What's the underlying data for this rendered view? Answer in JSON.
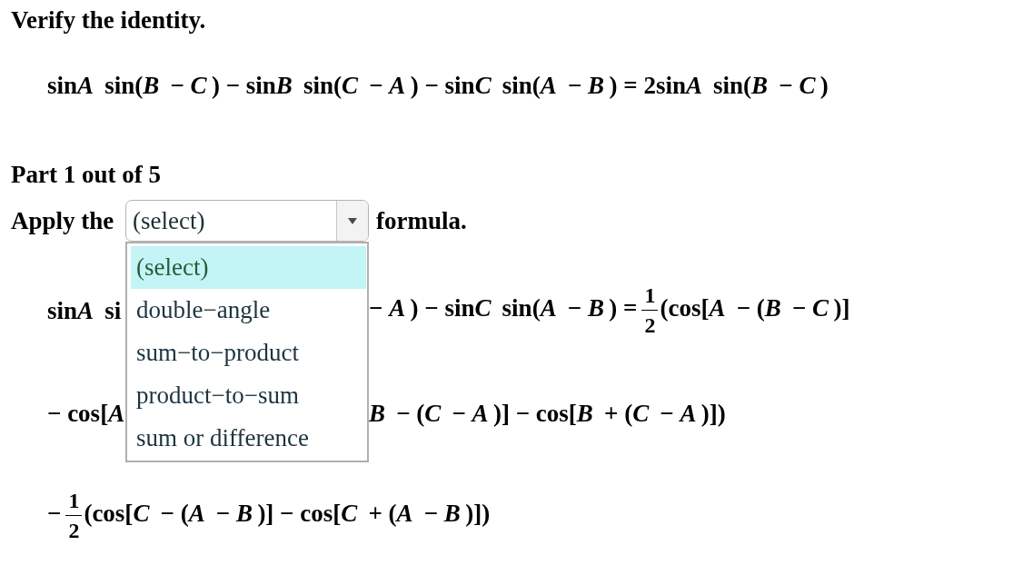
{
  "heading": "Verify the identity.",
  "identity": [
    {
      "kind": "text",
      "text": "sin"
    },
    {
      "kind": "var",
      "text": "A"
    },
    {
      "kind": "text",
      "text": " sin("
    },
    {
      "kind": "var",
      "text": "B"
    },
    {
      "kind": "text",
      "text": " − "
    },
    {
      "kind": "var",
      "text": "C"
    },
    {
      "kind": "text",
      "text": ") − sin"
    },
    {
      "kind": "var",
      "text": "B"
    },
    {
      "kind": "text",
      "text": " sin("
    },
    {
      "kind": "var",
      "text": "C"
    },
    {
      "kind": "text",
      "text": " − "
    },
    {
      "kind": "var",
      "text": "A"
    },
    {
      "kind": "text",
      "text": ") − sin"
    },
    {
      "kind": "var",
      "text": "C"
    },
    {
      "kind": "text",
      "text": " sin("
    },
    {
      "kind": "var",
      "text": "A"
    },
    {
      "kind": "text",
      "text": " − "
    },
    {
      "kind": "var",
      "text": "B"
    },
    {
      "kind": "text",
      "text": ") = 2sin"
    },
    {
      "kind": "var",
      "text": "A"
    },
    {
      "kind": "text",
      "text": " sin("
    },
    {
      "kind": "var",
      "text": "B"
    },
    {
      "kind": "text",
      "text": " − "
    },
    {
      "kind": "var",
      "text": "C"
    },
    {
      "kind": "text",
      "text": ")"
    }
  ],
  "part": "Part 1 out of 5",
  "prompt": {
    "before": "Apply the",
    "select": {
      "value": "(select)",
      "expanded": true,
      "options": [
        {
          "label": "(select)",
          "selected": true
        },
        {
          "label": "double−angle",
          "selected": false
        },
        {
          "label": "sum−to−product",
          "selected": false
        },
        {
          "label": "product−to−sum",
          "selected": false
        },
        {
          "label": "sum or difference",
          "selected": false
        }
      ]
    },
    "after": "formula."
  },
  "steps": [
    {
      "left": [
        {
          "kind": "text",
          "text": "sin"
        },
        {
          "kind": "var",
          "text": "A"
        },
        {
          "kind": "text",
          "text": " si"
        }
      ],
      "right": [
        {
          "kind": "text",
          "text": "− "
        },
        {
          "kind": "var",
          "text": "A"
        },
        {
          "kind": "text",
          "text": ") − sin"
        },
        {
          "kind": "var",
          "text": "C"
        },
        {
          "kind": "text",
          "text": " sin("
        },
        {
          "kind": "var",
          "text": "A"
        },
        {
          "kind": "text",
          "text": " − "
        },
        {
          "kind": "var",
          "text": "B"
        },
        {
          "kind": "text",
          "text": ") ="
        },
        {
          "kind": "fraction",
          "numerator": "1",
          "denominator": "2"
        },
        {
          "kind": "text",
          "text": "(cos["
        },
        {
          "kind": "var",
          "text": "A"
        },
        {
          "kind": "text",
          "text": " − ("
        },
        {
          "kind": "var",
          "text": "B"
        },
        {
          "kind": "text",
          "text": " − "
        },
        {
          "kind": "var",
          "text": "C"
        },
        {
          "kind": "text",
          "text": ")]"
        }
      ]
    },
    {
      "left": [
        {
          "kind": "text",
          "text": "− cos["
        },
        {
          "kind": "var",
          "text": "A"
        }
      ],
      "right": [
        {
          "kind": "var",
          "text": "B"
        },
        {
          "kind": "text",
          "text": " − ("
        },
        {
          "kind": "var",
          "text": "C"
        },
        {
          "kind": "text",
          "text": " − "
        },
        {
          "kind": "var",
          "text": "A"
        },
        {
          "kind": "text",
          "text": ")] − cos["
        },
        {
          "kind": "var",
          "text": "B"
        },
        {
          "kind": "text",
          "text": " + ("
        },
        {
          "kind": "var",
          "text": "C"
        },
        {
          "kind": "text",
          "text": " − "
        },
        {
          "kind": "var",
          "text": "A"
        },
        {
          "kind": "text",
          "text": ")])"
        }
      ]
    },
    {
      "left": [
        {
          "kind": "text",
          "text": "−"
        },
        {
          "kind": "fraction",
          "numerator": "1",
          "denominator": "2"
        },
        {
          "kind": "text",
          "text": "(cos["
        },
        {
          "kind": "var",
          "text": "C"
        },
        {
          "kind": "text",
          "text": " − ("
        },
        {
          "kind": "var",
          "text": "A"
        },
        {
          "kind": "text",
          "text": " − "
        },
        {
          "kind": "var",
          "text": "B"
        },
        {
          "kind": "text",
          "text": ")] − cos["
        },
        {
          "kind": "var",
          "text": "C"
        },
        {
          "kind": "text",
          "text": " + ("
        },
        {
          "kind": "var",
          "text": "A"
        },
        {
          "kind": "text",
          "text": " − "
        },
        {
          "kind": "var",
          "text": "B"
        },
        {
          "kind": "text",
          "text": ")])"
        }
      ]
    }
  ]
}
